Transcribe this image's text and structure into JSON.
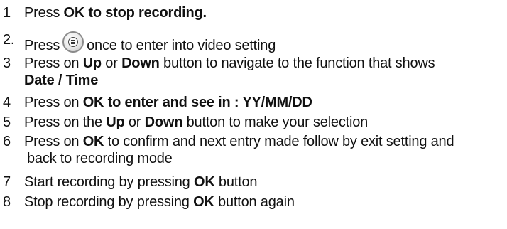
{
  "steps": [
    {
      "num": "1",
      "parts": [
        "Press ",
        "OK to stop recording."
      ]
    },
    {
      "num": "2.",
      "parts": [
        "Press",
        "once to enter into video setting"
      ],
      "icon": "menu-button-icon"
    },
    {
      "num": "3",
      "parts": [
        "Press on ",
        "Up",
        " or ",
        "Down",
        " button to navigate to the function that shows",
        "Date / Time"
      ]
    },
    {
      "num": "4",
      "parts": [
        "Press on ",
        "OK to enter and see in : YY/MM/DD"
      ]
    },
    {
      "num": "5",
      "parts": [
        "Press on the ",
        "Up",
        " or ",
        "Down",
        " button to make your selection"
      ]
    },
    {
      "num": "6",
      "parts": [
        "Press on ",
        "OK",
        " to confirm and next entry made follow by exit setting and",
        "back to recording mode"
      ]
    },
    {
      "num": "7",
      "parts": [
        "Start recording by pressing ",
        "OK",
        " button"
      ]
    },
    {
      "num": "8",
      "parts": [
        "Stop recording by pressing ",
        "OK",
        " button again"
      ]
    }
  ]
}
